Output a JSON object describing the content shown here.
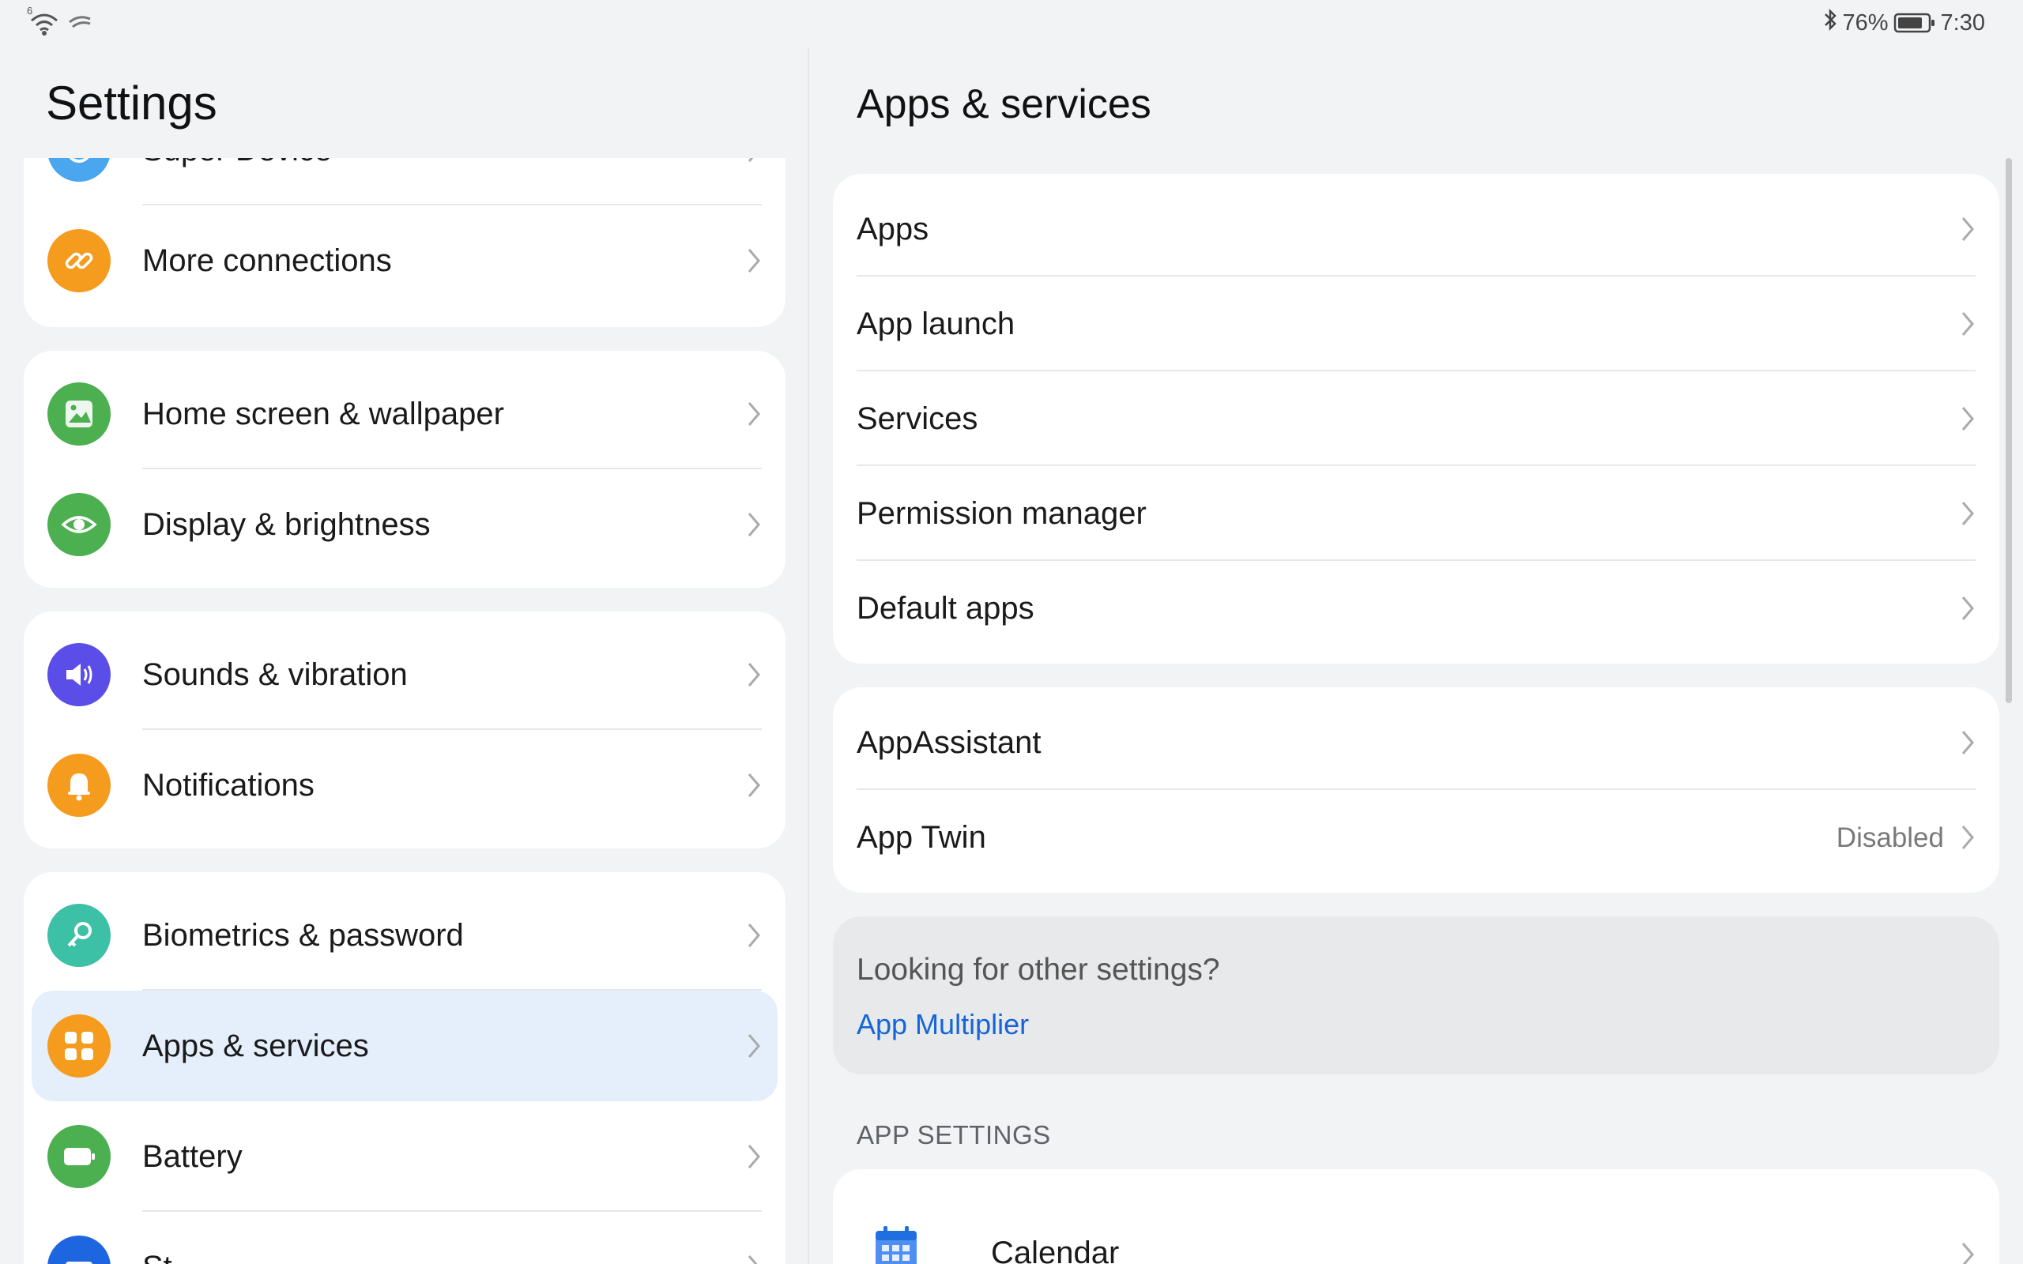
{
  "status_bar": {
    "wifi_badge": "6",
    "battery_percent": "76%",
    "time": "7:30"
  },
  "left": {
    "title": "Settings",
    "items": [
      {
        "label": "Super Device",
        "icon": "super-device-icon",
        "color": "#4a9ff0"
      },
      {
        "label": "More connections",
        "icon": "link-icon",
        "color": "#f59b1e"
      },
      {
        "label": "Home screen & wallpaper",
        "icon": "wallpaper-icon",
        "color": "#4caf50"
      },
      {
        "label": "Display & brightness",
        "icon": "eye-icon",
        "color": "#4caf50"
      },
      {
        "label": "Sounds & vibration",
        "icon": "speaker-icon",
        "color": "#5b4de8"
      },
      {
        "label": "Notifications",
        "icon": "bell-icon",
        "color": "#f59b1e"
      },
      {
        "label": "Biometrics & password",
        "icon": "key-icon",
        "color": "#3cc0a6"
      },
      {
        "label": "Apps & services",
        "icon": "apps-grid-icon",
        "color": "#f59b1e",
        "selected": true
      },
      {
        "label": "Battery",
        "icon": "battery-icon",
        "color": "#4caf50"
      },
      {
        "label": "St",
        "icon": "storage-icon",
        "color": "#1e66e0"
      }
    ]
  },
  "right": {
    "title": "Apps & services",
    "group1": [
      {
        "label": "Apps"
      },
      {
        "label": "App launch"
      },
      {
        "label": "Services"
      },
      {
        "label": "Permission manager"
      },
      {
        "label": "Default apps"
      }
    ],
    "group2": [
      {
        "label": "AppAssistant",
        "value": ""
      },
      {
        "label": "App Twin",
        "value": "Disabled"
      }
    ],
    "hint": {
      "question": "Looking for other settings?",
      "link": "App Multiplier"
    },
    "section_header": "APP SETTINGS",
    "app_settings": [
      {
        "label": "Calendar",
        "icon": "calendar-icon"
      }
    ]
  },
  "colors": {
    "background": "#f1f3f5",
    "accent_link": "#1565d8",
    "selected_row": "#e5effc"
  }
}
